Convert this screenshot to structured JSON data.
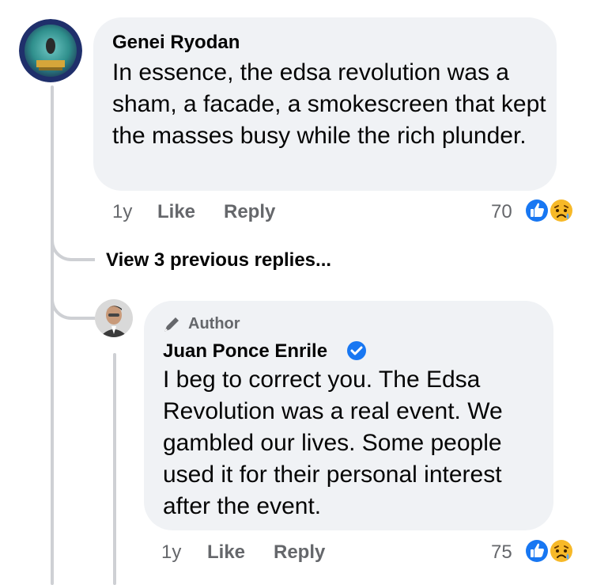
{
  "colors": {
    "bubble_bg": "#f0f2f5",
    "meta_text": "#65676b",
    "like_blue": "#1877f2",
    "sad_yellow": "#f7b928"
  },
  "comment1": {
    "name": "Genei Ryodan",
    "text": "In essence, the edsa revolution was a sham, a facade, a smokescreen that kept the masses busy while the rich plunder.",
    "time": "1y",
    "like_label": "Like",
    "reply_label": "Reply",
    "reaction_count": "70",
    "reactions": [
      "like-icon",
      "sad-icon"
    ]
  },
  "view_previous": "View 3 previous replies...",
  "reply1": {
    "badge_label": "Author",
    "badge_icon": "pen-icon",
    "name": "Juan Ponce Enrile",
    "verified_icon": "verified-check-icon",
    "text": "I beg to correct you. The Edsa Revolution  was a real event. We gambled our lives. Some people used it for their personal interest after the event.",
    "time": "1y",
    "like_label": "Like",
    "reply_label": "Reply",
    "reaction_count": "75",
    "reactions": [
      "like-icon",
      "sad-icon"
    ]
  }
}
